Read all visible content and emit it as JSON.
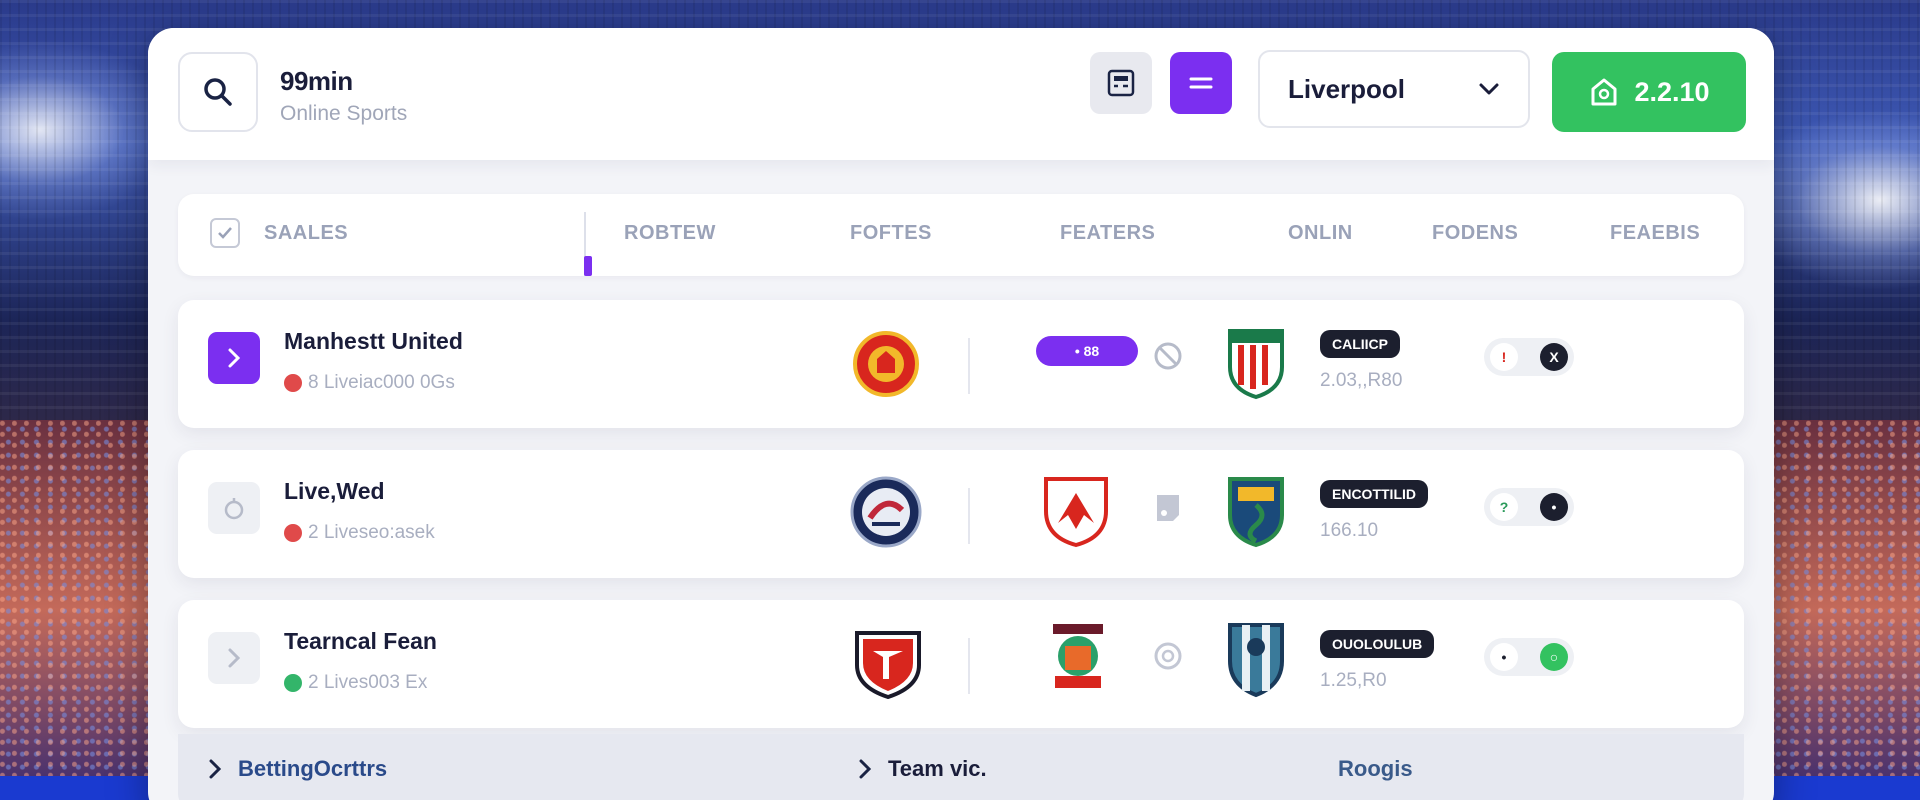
{
  "header": {
    "brand_title": "99min",
    "brand_subtitle": "Online Sports",
    "team_select_value": "Liverpool",
    "balance_label": "2.2.10"
  },
  "table": {
    "columns": [
      "SAALES",
      "ROBTEW",
      "FOFTES",
      "FEATERS",
      "ONLIN",
      "FODENS",
      "FEAEBIS"
    ],
    "rows": [
      {
        "name": "Manhestt United",
        "meta": "8 Liveiac000 0Gs",
        "meta_dot_color": "#e04a4a",
        "pill": "• 88",
        "tag": "CALIICP",
        "odds": "2.03,,R80",
        "arrow_active": true,
        "toggle_left": "!",
        "toggle_right": "X"
      },
      {
        "name": "Live,Wed",
        "meta": "2 Liveseo:asek",
        "meta_dot_color": "#e04a4a",
        "pill": "",
        "tag": "ENCOTTILID",
        "odds": "166.10",
        "arrow_active": false,
        "toggle_left": "?",
        "toggle_right": "•"
      },
      {
        "name": "Tearncal Fean",
        "meta": "2 Lives003 Ex",
        "meta_dot_color": "#33b56a",
        "pill": "",
        "tag": "OUOLOULUB",
        "odds": "1.25,R0",
        "arrow_active": false,
        "toggle_left": "•",
        "toggle_right": "○"
      }
    ]
  },
  "footer": {
    "left_label": "BettingOcrttrs",
    "mid_label": "Team vic.",
    "right_label": "Roogis"
  },
  "colors": {
    "accent": "#7b2ff0",
    "success": "#33c260",
    "text_dark": "#1a1d3a",
    "text_muted": "#a8aec0"
  },
  "icons": [
    "search-icon",
    "calculator-icon",
    "menu-icon",
    "chevron-down-icon",
    "wallet-icon",
    "check-icon",
    "chevron-right-icon",
    "team-crest-icon",
    "ban-icon",
    "clipboard-icon",
    "coin-icon"
  ]
}
